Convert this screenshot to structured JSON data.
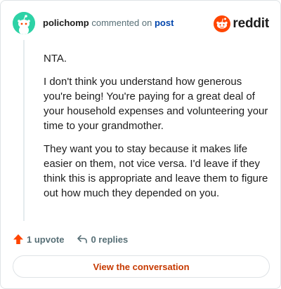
{
  "header": {
    "username": "polichomp",
    "action_text": "commented on",
    "post_link": "post",
    "brand_name": "reddit"
  },
  "comment": {
    "paragraphs": [
      "NTA.",
      "I don't think you understand how generous you're being! You're paying for a great deal of your household expenses and volunteering your time to your grandmother.",
      "They want you to stay because it makes life easier on them, not vice versa. I'd leave if they think this is appropriate and leave them to figure out how much they depended on you."
    ]
  },
  "footer": {
    "upvotes_label": "1 upvote",
    "replies_label": "0 replies"
  },
  "cta": {
    "label": "View the conversation"
  },
  "colors": {
    "brand_orange": "#ff4500",
    "avatar_green": "#2ed2a6",
    "link_blue": "#0045ac",
    "cta_text": "#c63900"
  },
  "icons": {
    "avatar": "snoo-avatar-icon",
    "brand": "reddit-logo-icon",
    "upvote": "upvote-arrow-icon",
    "reply": "reply-arrow-icon"
  }
}
